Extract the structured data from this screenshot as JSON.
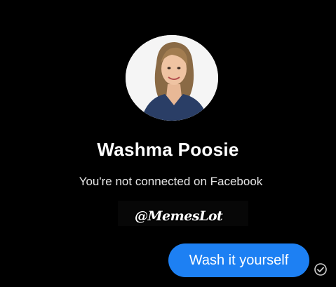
{
  "profile": {
    "name": "Washma Poosie",
    "connection_status": "You're not connected on Facebook"
  },
  "watermark": {
    "text": "@MemesLot"
  },
  "conversation": {
    "messages": [
      {
        "text": "Wash it yourself",
        "direction": "outgoing",
        "status_icon": "seen-check-icon"
      }
    ]
  },
  "colors": {
    "background": "#000000",
    "bubble": "#1d80f3",
    "text": "#ffffff"
  }
}
